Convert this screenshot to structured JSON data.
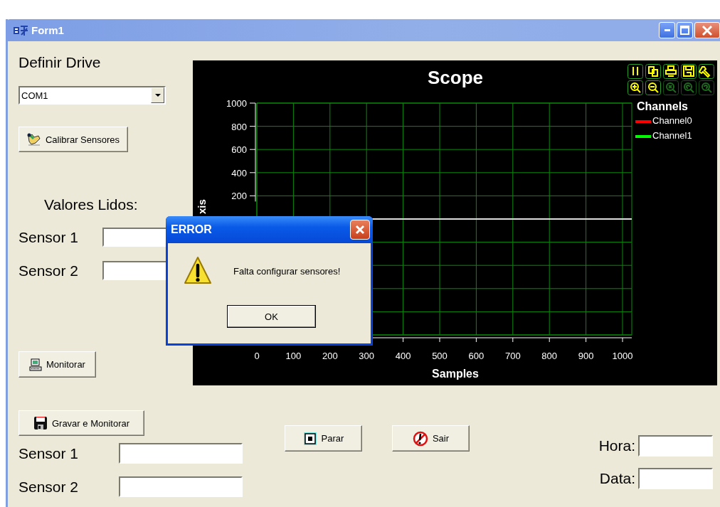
{
  "window": {
    "title": "Form1"
  },
  "left_panel": {
    "heading": "Definir Drive",
    "drive_select": {
      "value": "COM1"
    },
    "calibrate_button": "Calibrar Sensores",
    "readings_heading": "Valores Lidos:",
    "readings": [
      {
        "label": "Sensor 1"
      },
      {
        "label": "Sensor 2"
      }
    ],
    "monitor_button": "Monitorar"
  },
  "scope": {
    "toolbar": [
      {
        "kind": "pause",
        "disabled": false
      },
      {
        "kind": "copy",
        "disabled": false
      },
      {
        "kind": "print",
        "disabled": false
      },
      {
        "kind": "save",
        "disabled": false
      },
      {
        "kind": "wrench",
        "disabled": false
      },
      {
        "kind": "zoom-in",
        "disabled": false
      },
      {
        "kind": "zoom-out",
        "disabled": false
      },
      {
        "kind": "zoom-reset",
        "disabled": true
      },
      {
        "kind": "zoom-back",
        "disabled": true
      },
      {
        "kind": "zoom-forward",
        "disabled": true
      }
    ],
    "legend_title": "Channels",
    "chart_data": {
      "type": "line",
      "title": "Scope",
      "xlabel": "Samples",
      "ylabel": "xis",
      "categories": [
        "0",
        "100",
        "200",
        "300",
        "400",
        "500",
        "600",
        "700",
        "800",
        "900",
        "1000"
      ],
      "grid": true,
      "ylim": [
        -1000,
        1000
      ],
      "yticks": [
        200,
        400,
        600,
        800,
        1000
      ],
      "series": [
        {
          "name": "Channel0",
          "color": "#ff0000",
          "values": [
            null,
            null,
            null,
            null,
            null,
            null,
            null,
            null,
            null,
            null,
            null
          ]
        },
        {
          "name": "Channel1",
          "color": "#00ff00",
          "values": [
            null,
            null,
            null,
            null,
            null,
            null,
            null,
            null,
            null,
            null,
            null
          ]
        }
      ]
    }
  },
  "bottom": {
    "record_button": "Gravar e Monitorar",
    "readings": [
      {
        "label": "Sensor 1"
      },
      {
        "label": "Sensor 2"
      }
    ],
    "stop_button": "Parar",
    "exit_button": "Sair",
    "time_label": "Hora:",
    "date_label": "Data:"
  },
  "dialog": {
    "title": "ERROR",
    "message": "Falta configurar sensores!",
    "button": "OK"
  }
}
